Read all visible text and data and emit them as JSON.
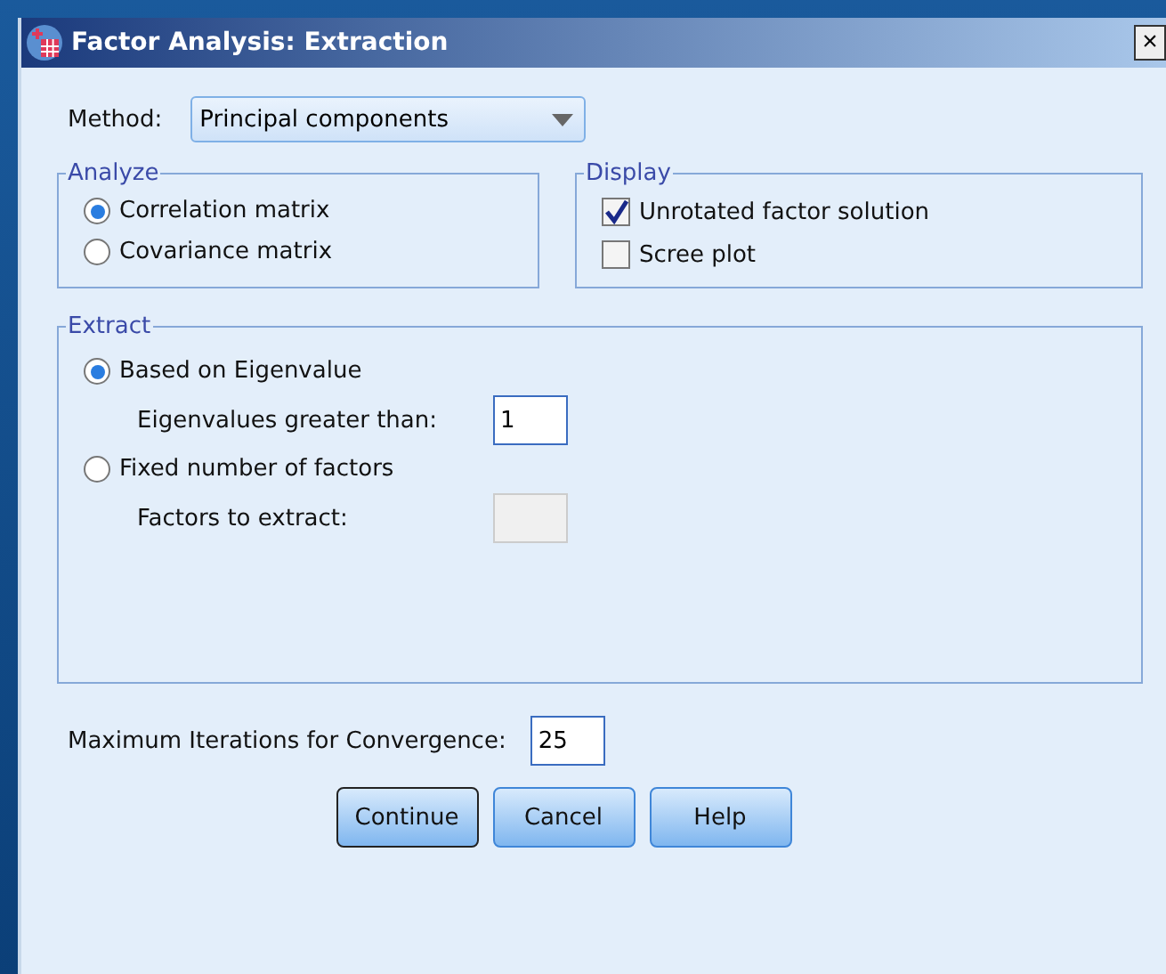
{
  "window": {
    "title": "Factor Analysis: Extraction",
    "close": "×"
  },
  "method": {
    "label": "Method:",
    "value": "Principal components"
  },
  "analyze": {
    "title": "Analyze",
    "options": [
      {
        "label": "Correlation matrix",
        "selected": true
      },
      {
        "label": "Covariance matrix",
        "selected": false
      }
    ]
  },
  "display": {
    "title": "Display",
    "options": [
      {
        "label": "Unrotated factor solution",
        "checked": true
      },
      {
        "label": "Scree plot",
        "checked": false
      }
    ]
  },
  "extract": {
    "title": "Extract",
    "options": [
      {
        "label": "Based on Eigenvalue",
        "selected": true,
        "field": {
          "label": "Eigenvalues greater than:",
          "value": "1",
          "disabled": false
        }
      },
      {
        "label": "Fixed number of factors",
        "selected": false,
        "field": {
          "label": "Factors to extract:",
          "disabled": true
        }
      }
    ]
  },
  "iterations": {
    "label": "Maximum Iterations for Convergence:",
    "value": "25"
  },
  "buttons": [
    {
      "label": "Continue",
      "default": true
    },
    {
      "label": "Cancel",
      "default": false
    },
    {
      "label": "Help",
      "default": false
    }
  ]
}
